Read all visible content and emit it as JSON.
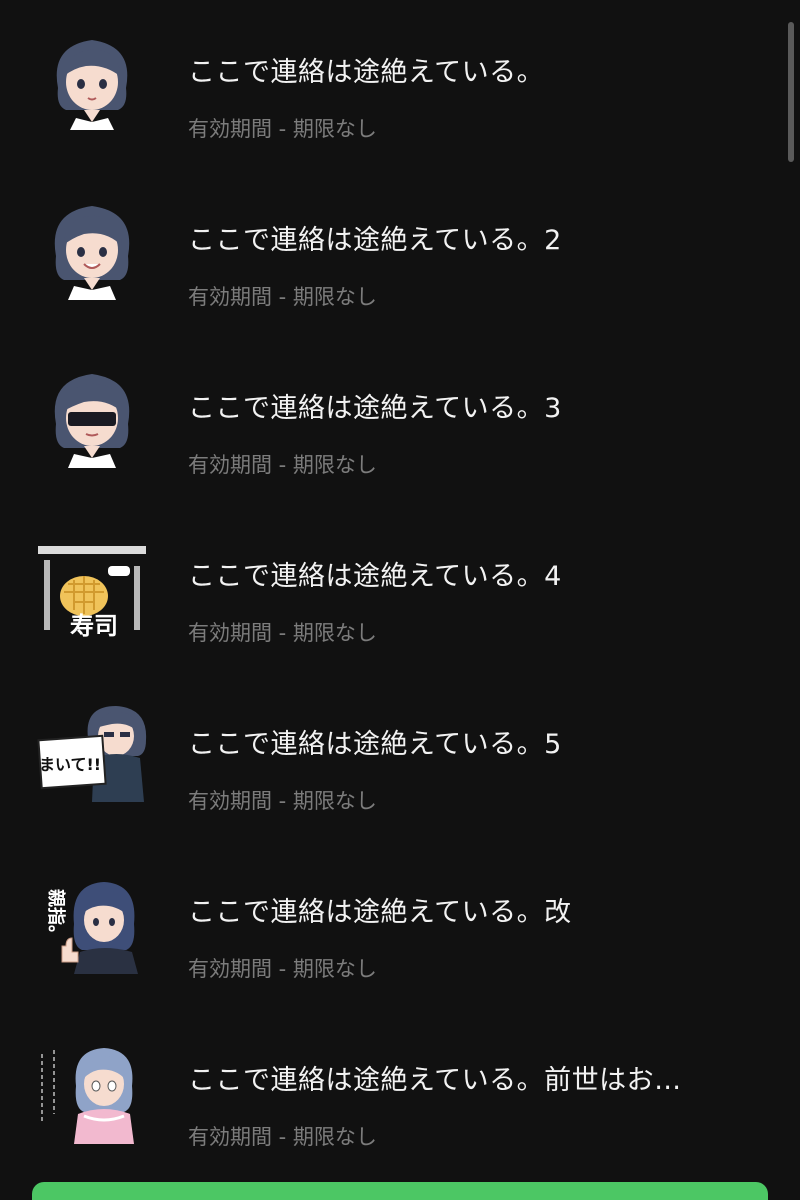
{
  "stickers": [
    {
      "title": "ここで連絡は途絶えている。",
      "subtitle": "有効期間 - 期限なし",
      "icon": "girl-avatar-icon"
    },
    {
      "title": "ここで連絡は途絶えている。2",
      "subtitle": "有効期間 - 期限なし",
      "icon": "smiling-girl-avatar-icon"
    },
    {
      "title": "ここで連絡は途絶えている。3",
      "subtitle": "有効期間 - 期限なし",
      "icon": "sunglasses-girl-avatar-icon"
    },
    {
      "title": "ここで連絡は途絶えている。4",
      "subtitle": "有効期間 - 期限なし",
      "icon": "melon-bread-sushi-icon",
      "thumb_text": "寿司"
    },
    {
      "title": "ここで連絡は途絶えている。5",
      "subtitle": "有効期間 - 期限なし",
      "icon": "girl-holding-sign-icon",
      "thumb_text": "まいて!!"
    },
    {
      "title": "ここで連絡は途絶えている。改",
      "subtitle": "有効期間 - 期限なし",
      "icon": "thumbs-up-girl-icon",
      "thumb_text": "親指。"
    },
    {
      "title": "ここで連絡は途絶えている。前世はお…",
      "subtitle": "有効期間 - 期限なし",
      "icon": "pink-dress-girl-icon"
    }
  ],
  "colors": {
    "background": "#111111",
    "title": "#f2f2f2",
    "subtitle": "#7c7c7c",
    "accent": "#4cc764"
  }
}
